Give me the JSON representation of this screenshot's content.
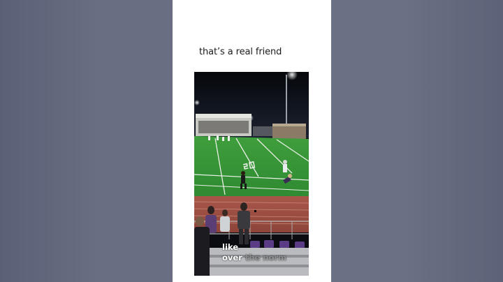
{
  "post": {
    "caption": "that’s a real friend"
  },
  "video": {
    "subtitle_line1": "like",
    "subtitle_line2_active": "over",
    "subtitle_line2_upcoming": " the norm"
  }
}
